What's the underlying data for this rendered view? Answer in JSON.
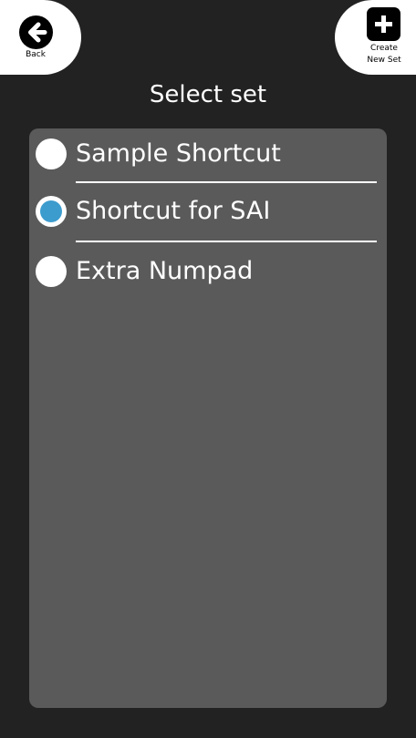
{
  "header": {
    "back_label": "Back",
    "create_label_line1": "Create",
    "create_label_line2": "New Set",
    "title": "Select set"
  },
  "options": [
    {
      "label": "Sample Shortcut",
      "selected": false
    },
    {
      "label": "Shortcut for SAI",
      "selected": true
    },
    {
      "label": "Extra Numpad",
      "selected": false
    }
  ],
  "colors": {
    "background": "#222222",
    "panel": "#5a5a5a",
    "selected_radio": "#3c9cce",
    "button_background": "#ffffff"
  },
  "icons": {
    "back": "back-arrow-circle-icon",
    "create": "plus-square-icon"
  }
}
